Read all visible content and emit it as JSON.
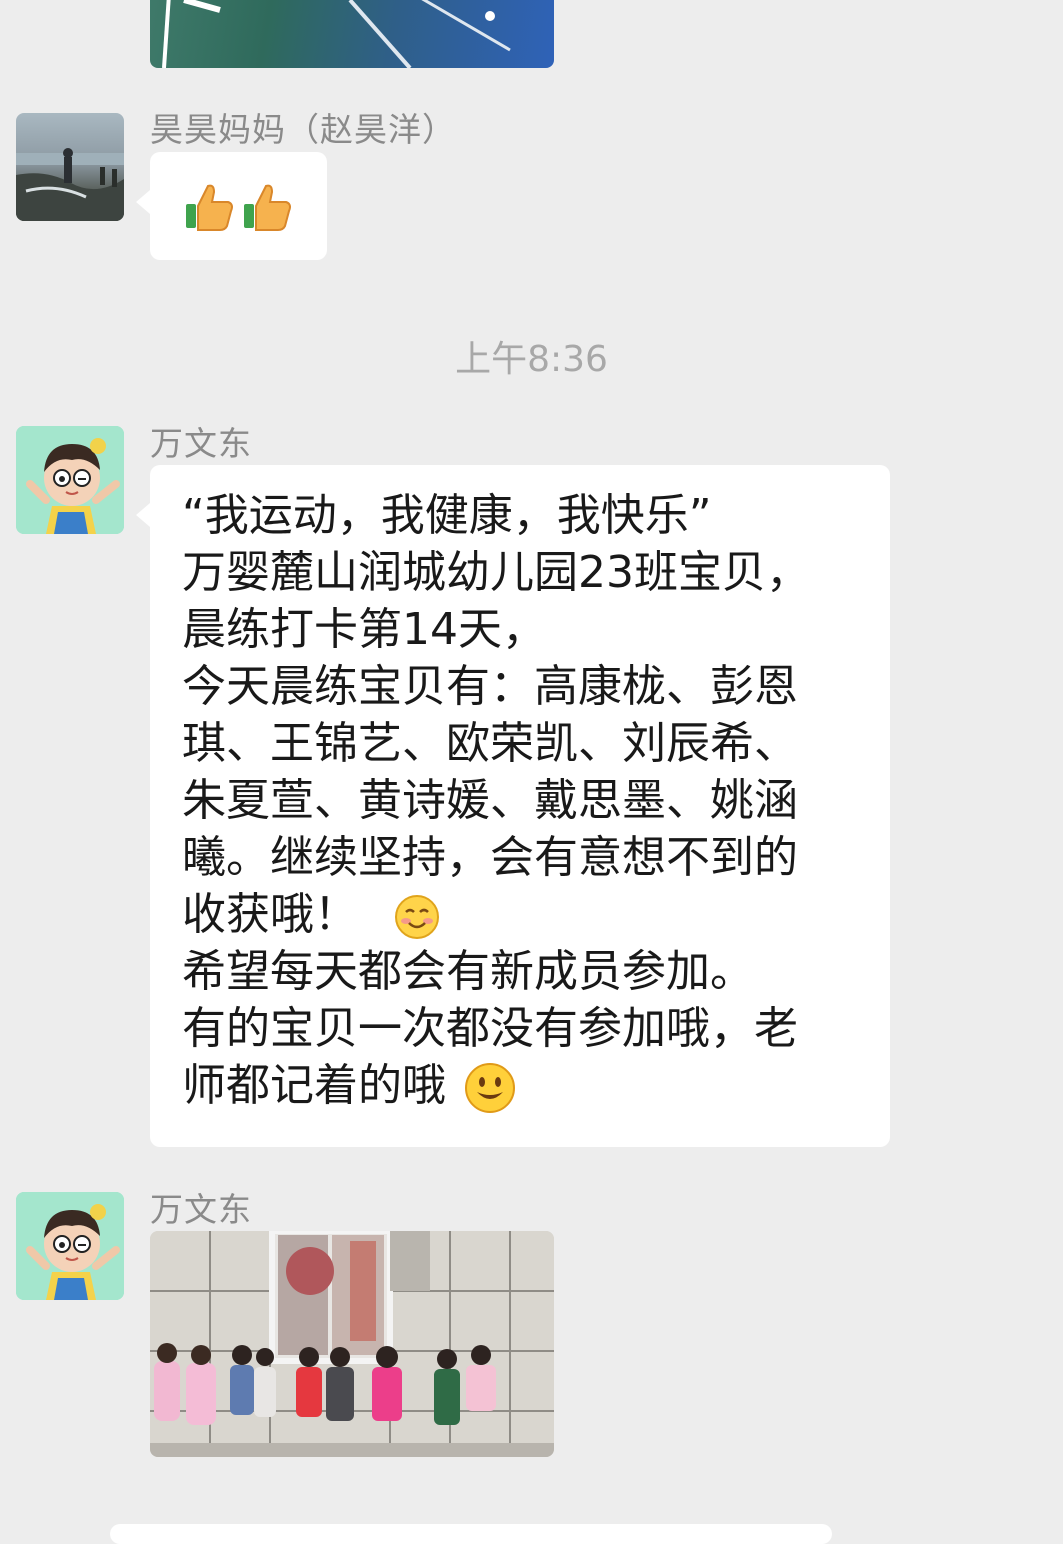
{
  "messages": [
    {
      "sender": "昊昊妈妈（赵昊洋）",
      "content": "👍👍"
    },
    {
      "sender": "万文东",
      "lines": [
        "“我运动，我健康，我快乐”",
        "万婴麓山润城幼儿园23班宝贝，",
        "晨练打卡第14天，",
        "今天晨练宝贝有：高康栊、彭恩",
        "琪、王锦艺、欧荣凯、刘辰希、",
        "朱夏萱、黄诗媛、戴思墨、姚涵",
        "曦。继续坚持，会有意想不到的",
        "收获哦！",
        "希望每天都会有新成员参加。",
        "有的宝贝一次都没有参加哦，老",
        "师都记着的哦"
      ],
      "emoji_after_line_8": "blush-smile-icon",
      "emoji_after_line_11": "smile-icon"
    },
    {
      "sender": "万文东",
      "content": "photo"
    }
  ],
  "timestamp": "上午8:36",
  "colors": {
    "background": "#ededed",
    "bubble": "#ffffff",
    "sender_text": "#8a8a8a",
    "timestamp_text": "#a8a8a8"
  }
}
